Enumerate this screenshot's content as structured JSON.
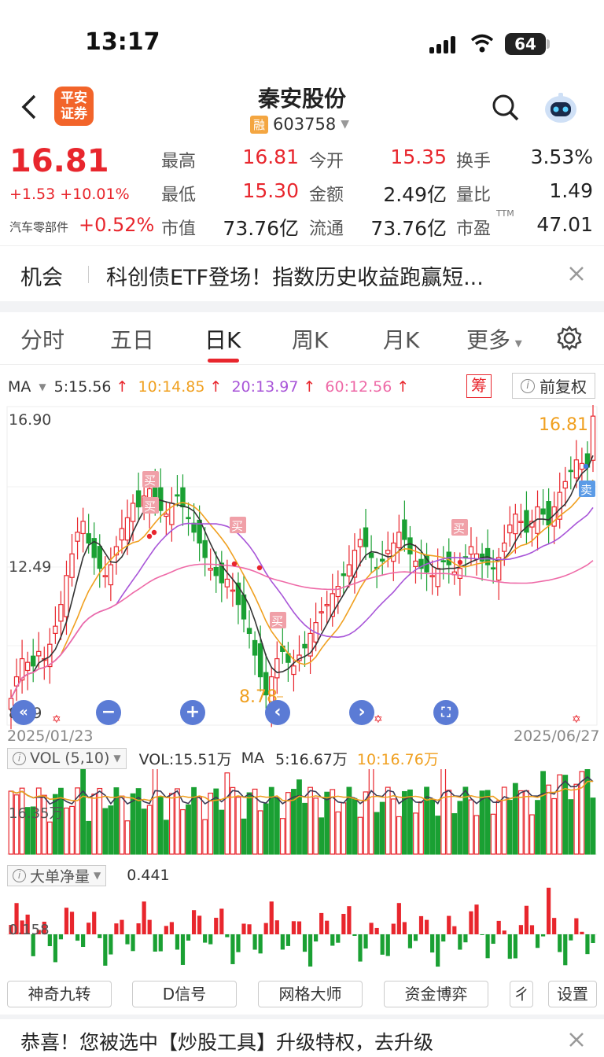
{
  "status_bar": {
    "time": "13:17",
    "battery": "64"
  },
  "header": {
    "broker_logo_line1": "平安",
    "broker_logo_line2": "证券",
    "stock_name": "秦安股份",
    "margin_tag": "融",
    "stock_code": "603758"
  },
  "quote": {
    "price": "16.81",
    "change": "+1.53 +10.01%",
    "sector_label": "汽车零部件",
    "sector_change": "+0.52%",
    "rows": [
      [
        {
          "label": "最高",
          "value": "16.81",
          "color": "red"
        },
        {
          "label": "今开",
          "value": "15.35",
          "color": "red"
        },
        {
          "label": "换手",
          "value": "3.53%",
          "color": "black"
        }
      ],
      [
        {
          "label": "最低",
          "value": "15.30",
          "color": "red"
        },
        {
          "label": "金额",
          "value": "2.49亿",
          "color": "black"
        },
        {
          "label": "量比",
          "value": "1.49",
          "color": "black"
        }
      ],
      [
        {
          "label": "市值",
          "value": "73.76亿",
          "color": "black"
        },
        {
          "label": "流通",
          "value": "73.76亿",
          "color": "black"
        },
        {
          "label": "市盈",
          "sup": "TTM",
          "value": "47.01",
          "color": "black"
        }
      ]
    ]
  },
  "news": {
    "tag": "机会",
    "text": "科创债ETF登场！指数历史收益跑赢短..."
  },
  "tabs": [
    "分时",
    "五日",
    "日K",
    "周K",
    "月K",
    "更多"
  ],
  "active_tab": "日K",
  "ma_legend": {
    "label": "MA",
    "items": [
      {
        "text": "5:15.56",
        "color": "#333"
      },
      {
        "text": "10:14.85",
        "color": "#f0a020"
      },
      {
        "text": "20:13.97",
        "color": "#a855d8"
      },
      {
        "text": "60:12.56",
        "color": "#ee6aa7"
      }
    ]
  },
  "chip_button": "筹",
  "adjust_button": "前复权",
  "kline": {
    "y_top_label": "16.90",
    "y_mid_label": "12.49",
    "y_bottom_label": "8.59",
    "high_marker": "16.81",
    "low_marker": "8.78",
    "start_date": "2025/01/23",
    "end_date": "2025/06/27",
    "buy_label": "买",
    "sell_label": "卖"
  },
  "vol_panel": {
    "title": "VOL (5,10)",
    "vol": "VOL:15.51万",
    "ma_label": "MA",
    "ma5": "5:16.67万",
    "ma10": "10:16.76万",
    "axis_label": "16.35万"
  },
  "net_panel": {
    "title": "大单净量",
    "value": "0.441",
    "axis_label": "0.158"
  },
  "indicator_chips": [
    "神奇九转",
    "D信号",
    "网格大师",
    "资金博弈",
    "ㄔ",
    "设置"
  ],
  "promo": {
    "text": "恭喜！您被选中【炒股工具】升级特权，去升级"
  },
  "colors": {
    "up": "#e8262d",
    "down": "#1aa033",
    "ma5": "#333333",
    "ma10": "#f0a020",
    "ma20": "#a855d8",
    "ma60": "#ee6aa7"
  }
}
